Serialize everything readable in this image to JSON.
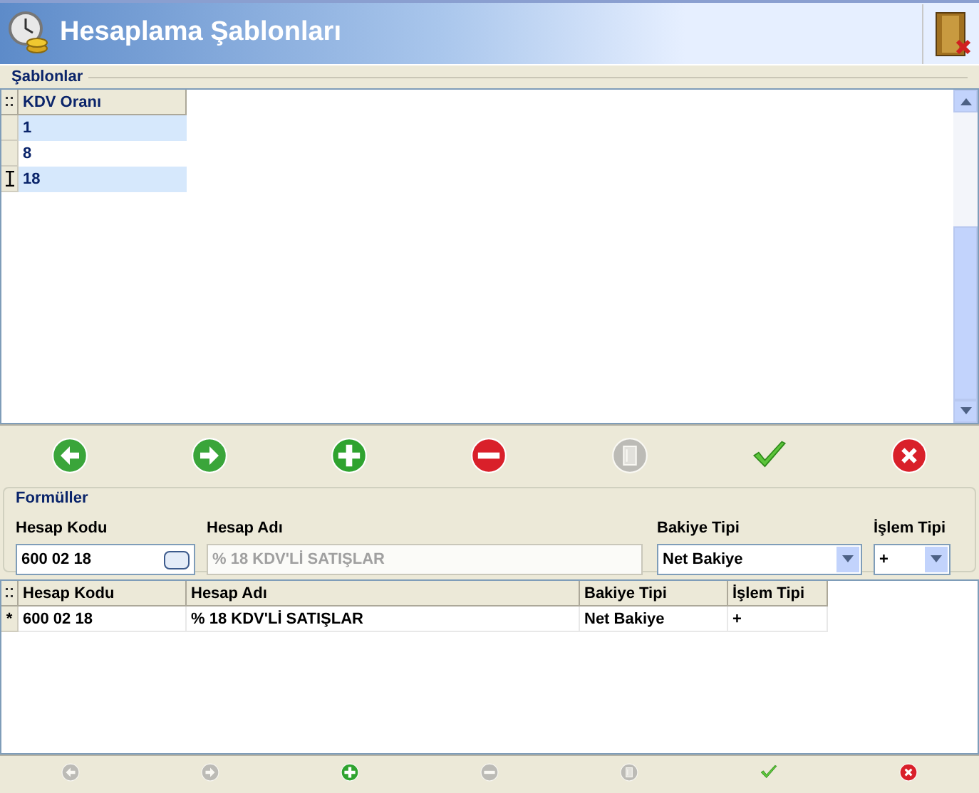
{
  "window": {
    "title": "Hesaplama Şablonları"
  },
  "templates": {
    "title": "Şablonlar",
    "columns": [
      "KDV Oranı"
    ],
    "rows": [
      {
        "cells": [
          "1"
        ],
        "current": false
      },
      {
        "cells": [
          "8"
        ],
        "current": false
      },
      {
        "cells": [
          "18"
        ],
        "current": true
      }
    ]
  },
  "toolbar": [
    {
      "kind": "prev",
      "disabled": false
    },
    {
      "kind": "next",
      "disabled": false
    },
    {
      "kind": "add",
      "disabled": false
    },
    {
      "kind": "remove",
      "disabled": false
    },
    {
      "kind": "edit",
      "disabled": true
    },
    {
      "kind": "save",
      "disabled": false
    },
    {
      "kind": "cancel",
      "disabled": false
    }
  ],
  "formulas": {
    "title": "Formüller",
    "fields": [
      {
        "kind": "lookup",
        "label": "Hesap Kodu",
        "value": "600 02 18"
      },
      {
        "kind": "text",
        "label": "Hesap Adı",
        "value": "% 18 KDV'Lİ SATIŞLAR",
        "disabled": true
      },
      {
        "kind": "select",
        "label": "Bakiye Tipi",
        "value": "Net Bakiye"
      },
      {
        "kind": "select",
        "label": "İşlem Tipi",
        "value": "+"
      }
    ],
    "columns": [
      "Hesap Kodu",
      "Hesap Adı",
      "Bakiye Tipi",
      "İşlem Tipi"
    ],
    "rows": [
      {
        "marker": "*",
        "cells": [
          "600 02 18",
          "% 18 KDV'Lİ SATIŞLAR",
          "Net Bakiye",
          "+"
        ]
      }
    ]
  },
  "bottom_toolbar": [
    {
      "kind": "prev",
      "disabled": true
    },
    {
      "kind": "next",
      "disabled": true
    },
    {
      "kind": "add",
      "disabled": false
    },
    {
      "kind": "remove",
      "disabled": true
    },
    {
      "kind": "edit",
      "disabled": true
    },
    {
      "kind": "save",
      "disabled": false
    },
    {
      "kind": "cancel",
      "disabled": false
    }
  ]
}
